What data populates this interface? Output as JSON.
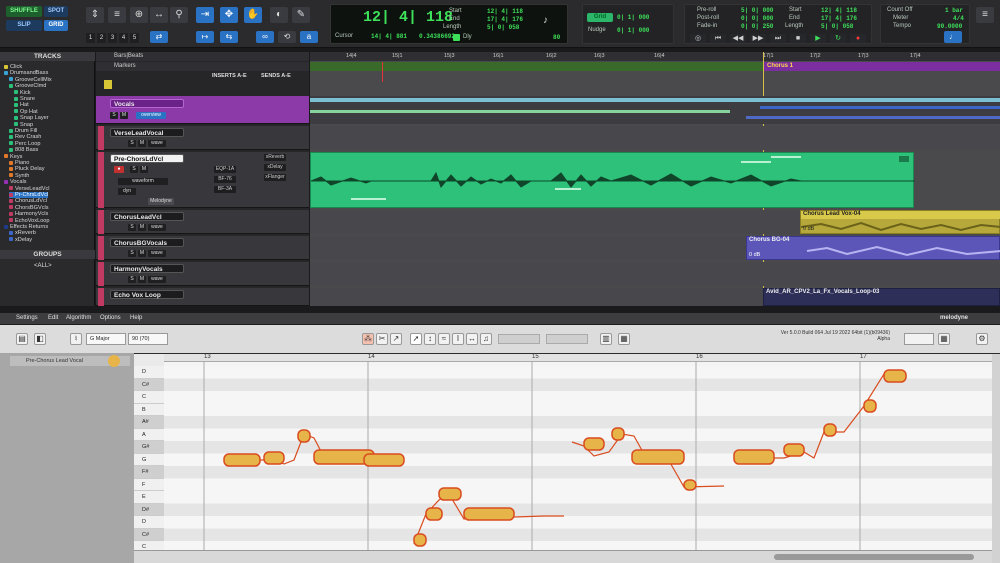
{
  "toolbar": {
    "modes": [
      "SHUFFLE",
      "SPOT",
      "SLIP",
      "GRID"
    ],
    "track_numbers": [
      "1",
      "2",
      "3",
      "4",
      "5"
    ],
    "main_counter": "12| 4| 118",
    "cursor_label": "Cursor",
    "cursor_value": "14| 4| 881",
    "cursor_extra": "0.34386692",
    "start_label": "Start",
    "end_label": "End",
    "length_label": "Length",
    "start_value": "12| 4| 118",
    "end_value": "17| 4| 176",
    "length_value": "5| 0| 058",
    "dly_label": "Dly",
    "tempo_small": "80",
    "grid_label": "Grid",
    "grid_value": "0| 1| 000",
    "nudge_label": "Nudge",
    "nudge_value": "0| 1| 000",
    "preroll_label": "Pre-roll",
    "postroll_label": "Post-roll",
    "fadein_label": "Fade-in",
    "preroll_value": "5| 0| 000",
    "postroll_value": "0| 0| 000",
    "fadein_value": "0| 0| 250",
    "transport_start": "12| 4| 118",
    "transport_end": "17| 4| 176",
    "transport_length": "5| 0| 058",
    "countoff_label": "Count Off",
    "countoff_value": "1 bar",
    "meter_label": "Meter",
    "meter_value": "4/4",
    "tempo_label": "Tempo",
    "tempo_value": "90.0000"
  },
  "tracks_panel": {
    "title": "TRACKS",
    "items": [
      "Click",
      "DrumsandBass",
      "GrooveCellMix",
      "GrooveClmd",
      "Kick",
      "Snare",
      "Hat",
      "Op Hat",
      "Snap Layer",
      "Snap",
      "Drum Fill",
      "Rev Crash",
      "Perc Loop",
      "808 Bass",
      "Keys",
      "Piano",
      "Pluck Delay",
      "Synth",
      "Vocals",
      "VerseLeadVcl",
      "Pr-ChrsLdVcl",
      "ChorusLdVcl",
      "ChorsBGVcls",
      "HarmonyVcls",
      "EchoVoxLoop",
      "Effects Returns",
      "xReverb",
      "xDelay"
    ],
    "groups_title": "GROUPS",
    "groups_all": "<ALL>"
  },
  "mix_panel": {
    "header": "Bars|Beats",
    "markers": "Markers",
    "inserts": "INSERTS A-E",
    "sends": "SENDS A-E",
    "tracks": [
      {
        "name": "Vocals",
        "view": "overview",
        "color": "#9a2fb7"
      },
      {
        "name": "VerseLeadVocal",
        "view": "wave",
        "color": "#c03a64"
      },
      {
        "name": "Pre-ChorsLdVcl",
        "view": "waveform",
        "color": "#c03a64"
      },
      {
        "name": "ChorusLeadVcl",
        "view": "wave",
        "color": "#c03a64"
      },
      {
        "name": "ChorusBGVocals",
        "view": "wave",
        "color": "#c03a64"
      },
      {
        "name": "HarmonyVocals",
        "view": "wave",
        "color": "#c03a64"
      },
      {
        "name": "Echo Vox Loop",
        "view": "wave",
        "color": "#c03a64"
      }
    ],
    "pre_chorus_inserts": [
      "EQP-1A",
      "BF-76",
      "BF-3A"
    ],
    "pre_chorus_sends": [
      "xReverb",
      "xDelay",
      "xFlanger"
    ],
    "melodyne_plugin": "Melodyne",
    "dyn": "dyn"
  },
  "timeline": {
    "ruler": [
      "14|4",
      "15|1",
      "15|3",
      "16|1",
      "16|2",
      "16|3",
      "16|4",
      "17|1",
      "17|2",
      "17|3",
      "17|4"
    ],
    "chorus_marker": "Chorus 1",
    "clips": [
      {
        "name": "Chorus Lead Vox-04",
        "gain": "0 dB"
      },
      {
        "name": "Chorus BG-04",
        "gain": "0 dB"
      },
      {
        "name": "Avid_AR_CPV2_La_Fx_Vocals_Loop-03",
        "gain": ""
      }
    ]
  },
  "melodyne": {
    "menu": [
      "Settings",
      "Edit",
      "Algorithm",
      "Options",
      "Help"
    ],
    "brand": "melodyne",
    "track_label": "Pre-Chorus Lead Vocal",
    "key": "G Major",
    "bpm": "90 (70)",
    "version": "Ver 5.0.0 Build 064 Jul 19 2022 64bit (1)(b09436) Alpha",
    "bars": [
      "13",
      "14",
      "15",
      "16",
      "17"
    ],
    "notes": [
      "D",
      "C#",
      "C",
      "B",
      "A#",
      "A",
      "G#",
      "G",
      "F#",
      "F",
      "E",
      "D#",
      "D",
      "C#",
      "C"
    ],
    "accent_color": "#d94c1f",
    "blob_color": "#e7b44a"
  }
}
